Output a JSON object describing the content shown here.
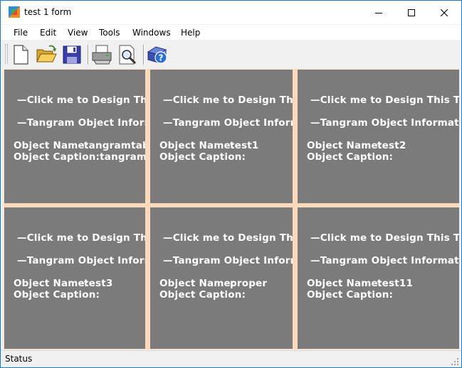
{
  "window": {
    "title": "test 1 form"
  },
  "menubar": {
    "items": [
      "File",
      "Edit",
      "View",
      "Tools",
      "Windows",
      "Help"
    ]
  },
  "toolbar": {
    "buttons": [
      {
        "icon": "new-document-icon"
      },
      {
        "icon": "open-folder-icon"
      },
      {
        "icon": "save-disk-icon"
      },
      {
        "icon": "print-icon"
      },
      {
        "icon": "print-preview-icon"
      },
      {
        "icon": "help-book-icon"
      }
    ]
  },
  "panels": [
    {
      "design_link": "—Click me to Design This Tangram Object—",
      "info_header": "—Tangram Object Information—",
      "name_label": "Object Name:",
      "name_value": "tangramtabctrl",
      "caption_label": "Object Caption:",
      "caption_value": "tangramtabctrl"
    },
    {
      "design_link": "—Click me to Design This Tangram Object—",
      "info_header": "—Tangram Object Information—",
      "name_label": "Object Name:",
      "name_value": "test1",
      "caption_label": "Object Caption:",
      "caption_value": ""
    },
    {
      "design_link": "—Click me to Design This Tangram Object—",
      "info_header": "—Tangram Object Information—",
      "name_label": "Object Name:",
      "name_value": "test2",
      "caption_label": "Object Caption:",
      "caption_value": ""
    },
    {
      "design_link": "—Click me to Design This Tangram Object—",
      "info_header": "—Tangram Object Information—",
      "name_label": "Object Name:",
      "name_value": "test3",
      "caption_label": "Object Caption:",
      "caption_value": ""
    },
    {
      "design_link": "—Click me to Design This Tangram Object—",
      "info_header": "—Tangram Object Information—",
      "name_label": "Object Name:",
      "name_value": "proper",
      "caption_label": "Object Caption:",
      "caption_value": ""
    },
    {
      "design_link": "—Click me to Design This Tangram Object—",
      "info_header": "—Tangram Object Information—",
      "name_label": "Object Name:",
      "name_value": "test11",
      "caption_label": "Object Caption:",
      "caption_value": ""
    }
  ],
  "statusbar": {
    "text": "Status"
  },
  "colors": {
    "panel_background": "#7b7b7b",
    "splitter": "#fdd9bb",
    "window_border": "#1979ca"
  }
}
